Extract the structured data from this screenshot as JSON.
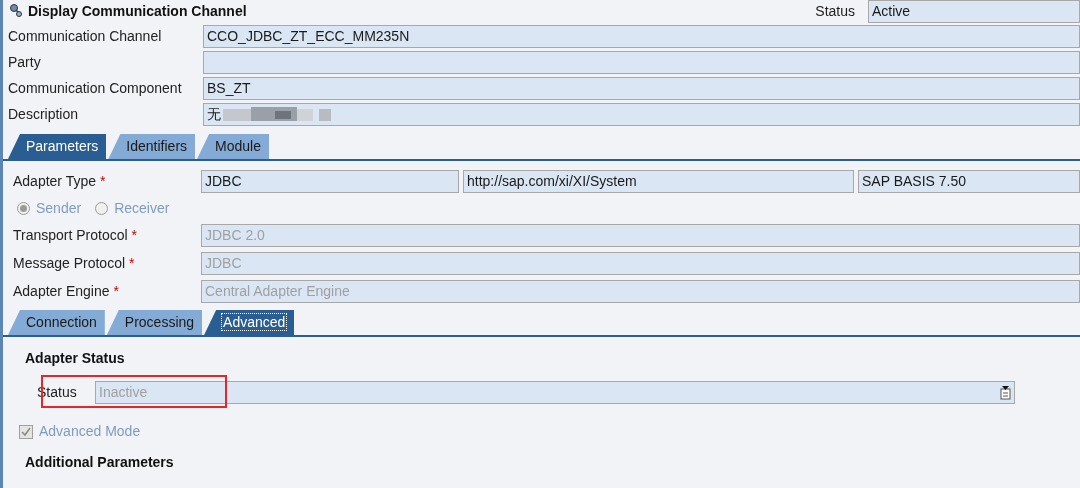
{
  "window": {
    "title": "Display Communication Channel"
  },
  "status": {
    "label": "Status",
    "value": "Active"
  },
  "header_fields": [
    {
      "label": "Communication Channel",
      "value": "CCO_JDBC_ZT_ECC_MM235N",
      "redacted": false
    },
    {
      "label": "Party",
      "redacted": false
    },
    {
      "label": "Communication Component",
      "value": "BS_ZT",
      "redacted": false
    },
    {
      "label": "Description",
      "value": "无",
      "redacted": true
    }
  ],
  "tabs": [
    {
      "label": "Parameters",
      "selected": true
    },
    {
      "label": "Identifiers",
      "selected": false
    },
    {
      "label": "Module",
      "selected": false
    }
  ],
  "adapter_type": {
    "label": "Adapter Type",
    "mark": "*",
    "values": [
      "JDBC",
      "http://sap.com/xi/XI/System",
      "SAP BASIS 7.50"
    ]
  },
  "direction": [
    {
      "label": "Sender",
      "selected": true
    },
    {
      "label": "Receiver",
      "selected": false
    }
  ],
  "protocol_fields": [
    {
      "label": "Transport Protocol",
      "mark": "*",
      "value": "JDBC 2.0",
      "disabled": true
    },
    {
      "label": "Message Protocol",
      "mark": "*",
      "value": "JDBC",
      "disabled": true
    },
    {
      "label": "Adapter Engine",
      "mark": "*",
      "value": "Central Adapter Engine",
      "disabled": true
    }
  ],
  "subtabs": [
    {
      "label": "Connection",
      "selected": false
    },
    {
      "label": "Processing",
      "selected": false
    },
    {
      "label": "Advanced",
      "selected": true
    }
  ],
  "adapter_status": {
    "heading": "Adapter Status",
    "label": "Status",
    "value": "Inactive",
    "highlighted": true
  },
  "advanced_mode": {
    "label": "Advanced Mode",
    "checked": true
  },
  "additional_parameters": {
    "heading": "Additional Parameters"
  }
}
